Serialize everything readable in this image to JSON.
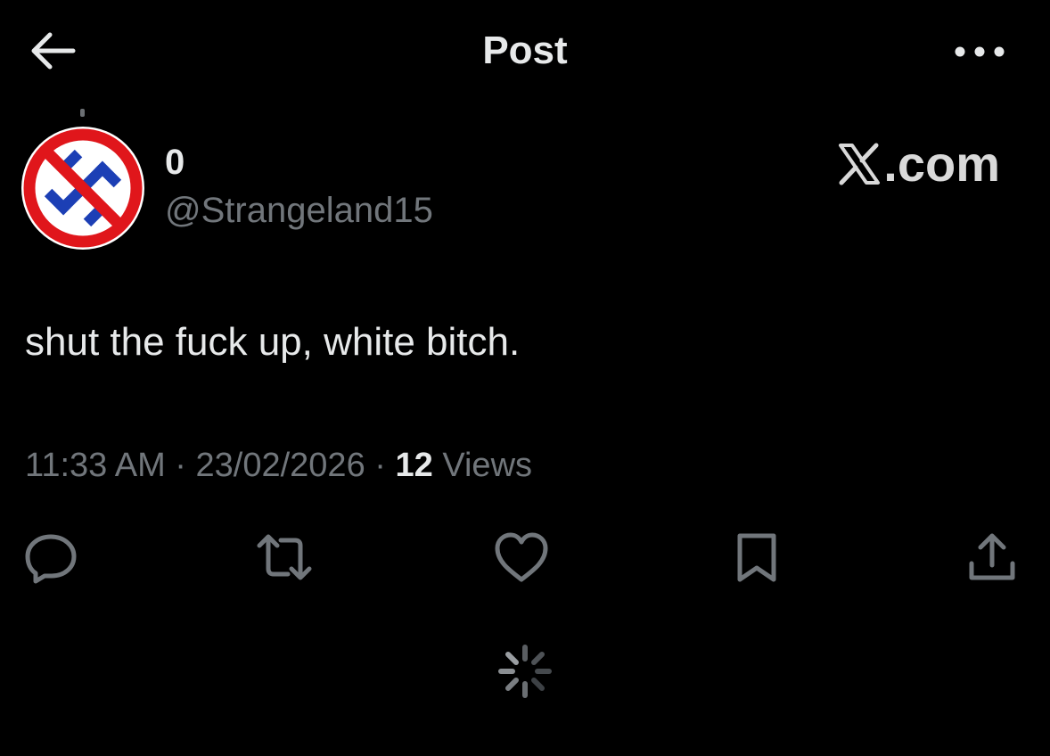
{
  "header": {
    "title": "Post",
    "back_icon": "arrow-left-icon",
    "more_icon": "more-horizontal-icon"
  },
  "author": {
    "display_name": "0",
    "handle": "@Strangeland15",
    "avatar_icon": "anti-swastika-prohibition-avatar"
  },
  "watermark": {
    "text": ".com",
    "logo": "x-logo"
  },
  "post": {
    "text": "shut the fuck up, white bitch.",
    "time": "11:33 AM",
    "date": "23/02/2026",
    "views_count": "12",
    "views_label": "Views",
    "separator": "·"
  },
  "actions": [
    {
      "name": "reply",
      "icon": "comment-icon"
    },
    {
      "name": "repost",
      "icon": "repost-icon"
    },
    {
      "name": "like",
      "icon": "heart-icon"
    },
    {
      "name": "bookmark",
      "icon": "bookmark-icon"
    },
    {
      "name": "share",
      "icon": "share-icon"
    }
  ],
  "colors": {
    "background": "#000000",
    "text_primary": "#e7e9ea",
    "text_secondary": "#71767b",
    "icon_gray": "#71767b",
    "avatar_red": "#e0161b",
    "avatar_blue": "#1c3fb5"
  }
}
